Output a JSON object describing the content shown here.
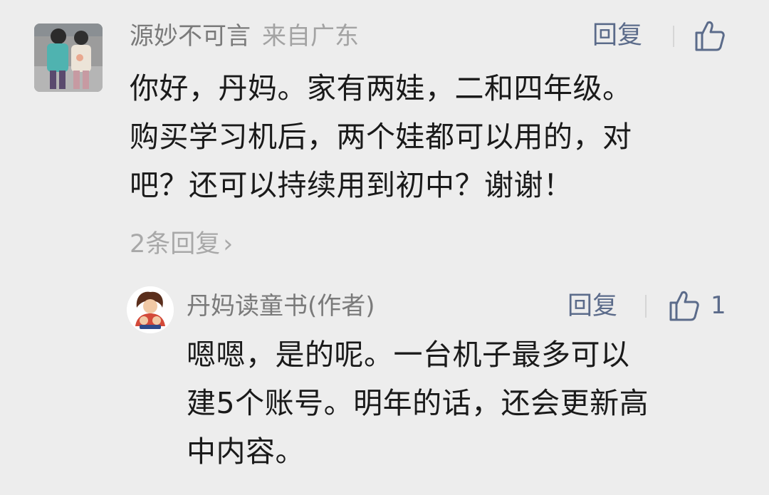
{
  "comment": {
    "author": "源妙不可言",
    "location": "来自广东",
    "reply_label": "回复",
    "text_lines": [
      "你好，丹妈。家有两娃，二和四年级。",
      "购买学习机后，两个娃都可以用的，对",
      "吧？还可以持续用到初中？谢谢！"
    ],
    "replies_count_label": "2条回复",
    "expand_icon": "chevron-right-icon",
    "like_icon": "thumbs-up-icon"
  },
  "reply": {
    "author": "丹妈读童书(作者)",
    "reply_label": "回复",
    "like_count": "1",
    "like_icon": "thumbs-up-icon",
    "text_lines": [
      "嗯嗯，是的呢。一台机子最多可以",
      "建5个账号。明年的话，还会更新高",
      "中内容。"
    ]
  },
  "colors": {
    "background": "#ededed",
    "link": "#5b6b8a",
    "author": "#7a7a7a",
    "body_text": "#1a1a1a",
    "muted": "#a8a8a8"
  }
}
